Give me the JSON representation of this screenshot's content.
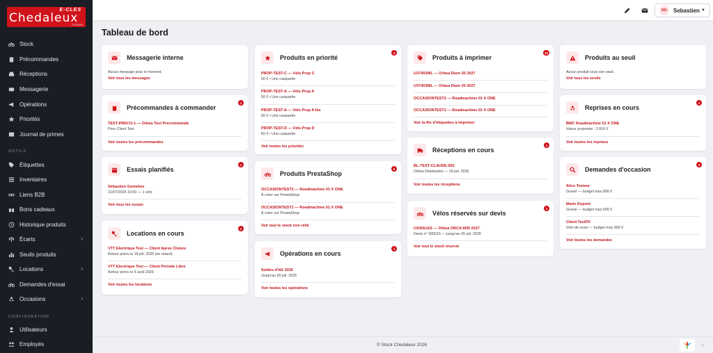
{
  "brand": {
    "top": "E-CLES",
    "main": "Chedaleux",
    "sub": "CYCLES"
  },
  "sidebar": {
    "items": [
      {
        "label": "Stock",
        "icon": "bicycle-icon"
      },
      {
        "label": "Précommandes",
        "icon": "clipboard-icon"
      },
      {
        "label": "Réceptions",
        "icon": "inbox-icon"
      },
      {
        "label": "Messagerie",
        "icon": "envelope-icon"
      },
      {
        "label": "Opérations",
        "icon": "megaphone-icon"
      },
      {
        "label": "Priorités",
        "icon": "star-icon"
      },
      {
        "label": "Journal de primes",
        "icon": "book-icon"
      }
    ],
    "section_outils": "OUTILS",
    "tools": [
      {
        "label": "Étiquettes",
        "icon": "tag-icon"
      },
      {
        "label": "Inventaires",
        "icon": "list-icon"
      },
      {
        "label": "Liens B2B",
        "icon": "link-icon"
      },
      {
        "label": "Bons cadeaux",
        "icon": "gift-icon"
      },
      {
        "label": "Historique produits",
        "icon": "history-icon"
      },
      {
        "label": "Écarts",
        "icon": "scale-icon"
      },
      {
        "label": "Seuils produits",
        "icon": "chart-icon"
      },
      {
        "label": "Locations",
        "icon": "key-icon"
      },
      {
        "label": "Demandes d'essai",
        "icon": "bicycle-icon"
      },
      {
        "label": "Occasions",
        "icon": "recycle-icon"
      }
    ],
    "section_config": "CONFIGURATION",
    "config": [
      {
        "label": "Utilisateurs",
        "icon": "users-icon"
      },
      {
        "label": "Employés",
        "icon": "people-icon"
      }
    ]
  },
  "topbar": {
    "avatar_initials": "SG",
    "user_name": "Sebastien"
  },
  "page_title": "Tableau de bord",
  "cards": {
    "messagerie": {
      "title": "Messagerie interne",
      "empty": "Aucun message pour le moment.",
      "link": "Voir tous les messages"
    },
    "precommandes": {
      "title": "Précommandes à commander",
      "badge": "1",
      "items": [
        {
          "label": "TEST-PRECO-1 — Orbea Test Precommande",
          "sub": "Pour Client Test"
        }
      ],
      "link": "Voir toutes les précommandes"
    },
    "essais": {
      "title": "Essais planifiés",
      "badge": "1",
      "items": [
        {
          "label": "Sébastien Gemeline",
          "sub": "21/07/2026 10:00 — 1 vélo"
        }
      ],
      "link": "Voir tous les essais"
    },
    "locations": {
      "title": "Locations en cours",
      "badge": "2",
      "items": [
        {
          "label": "VTT Electrique Test — Client Apres Cloture",
          "sub": "Retour prévu le 18 juil. 2026 (en retard)"
        },
        {
          "label": "VTT Electrique Test — Client Periode Libre",
          "sub": "Retour prévu le 5 août 2026"
        }
      ],
      "link": "Voir toutes les locations"
    },
    "priorite": {
      "title": "Produits en priorité",
      "badge": "4",
      "items": [
        {
          "label": "PROP-TEST-C — Vélo Prop C",
          "sub": "50 € • Une casquette"
        },
        {
          "label": "PROP-TEST-A — Vélo Prop A",
          "sub": "50 € • Une casquette"
        },
        {
          "label": "PROP-TEST-A — Vélo Prop A bis",
          "sub": "50 € • Une casquette"
        },
        {
          "label": "PROP-TEST-D — Vélo Prop D",
          "sub": "50 € • Une casquette"
        }
      ],
      "link": "Voir toutes les priorités"
    },
    "prestashop": {
      "title": "Produits PrestaShop",
      "badge": "6",
      "items": [
        {
          "label": "OCCASIONTEST2 — Roadmachine 01 X ONE",
          "sub": "À créer sur PrestaShop"
        },
        {
          "label": "OCCASIONTEST1 — Roadmachine 01 X ONE",
          "sub": "À créer sur PrestaShop"
        }
      ],
      "link": "Voir tout le stock non relié"
    },
    "operations": {
      "title": "Opérations en cours",
      "badge": "1",
      "items": [
        {
          "label": "Soldes d'été 2026",
          "sub": "Jusqu'au 30 juil. 2026"
        }
      ],
      "link": "Voir toutes les opérations"
    },
    "imprimer": {
      "title": "Produits à imprimer",
      "badge": "14",
      "items": [
        {
          "label": "U37403WL — Orbea Diem 30 2027"
        },
        {
          "label": "U37403WL — Orbea Diem 30 2027"
        },
        {
          "label": "OCCASIONTEST2 — Roadmachine 01 X ONE"
        },
        {
          "label": "OCCASIONTEST1 — Roadmachine 01 X ONE"
        }
      ],
      "link": "Voir la file d'étiquettes à imprimer"
    },
    "receptions": {
      "title": "Réceptions en cours",
      "badge": "1",
      "items": [
        {
          "label": "BL-TEST-CLAUDE-002",
          "sub": "Orbea Distribution — 19 juil. 2026"
        }
      ],
      "link": "Voir toutes les réceptions"
    },
    "velos": {
      "title": "Vélos réservés sur devis",
      "badge": "1",
      "items": [
        {
          "label": "U10651AS — Orbea ORCA M30 2027",
          "sub": "Devis n° 300215 — jusqu'au 26 juil. 2026"
        }
      ],
      "link": "Voir tout le stock réservé"
    },
    "seuil": {
      "title": "Produits au seuil",
      "empty": "Aucun produit sous son seuil.",
      "link": "Voir tous les seuils"
    },
    "reprises": {
      "title": "Reprises en cours",
      "badge": "1",
      "items": [
        {
          "label": "BMC Roadmachine 01 X ONE",
          "sub": "Valeur proposée : 2 816 €"
        }
      ],
      "link": "Voir toutes les reprises"
    },
    "occasion": {
      "title": "Demandes d'occasion",
      "badge": "3",
      "items": [
        {
          "label": "Alice Testeur",
          "sub": "Gravel — budget max 800 €"
        },
        {
          "label": "Marie Dupont",
          "sub": "Gravel — budget max 600 €"
        },
        {
          "label": "Client TestFK",
          "sub": "Vélo de route — budget max 900 €"
        }
      ],
      "link": "Voir toutes les demandes"
    }
  },
  "footer": {
    "copyright": "© Stock Chedaleux 2026"
  },
  "colors": {
    "accent": "#d0121b",
    "sidebar_bg": "#1b1d24",
    "page_bg": "#eef0f4"
  }
}
